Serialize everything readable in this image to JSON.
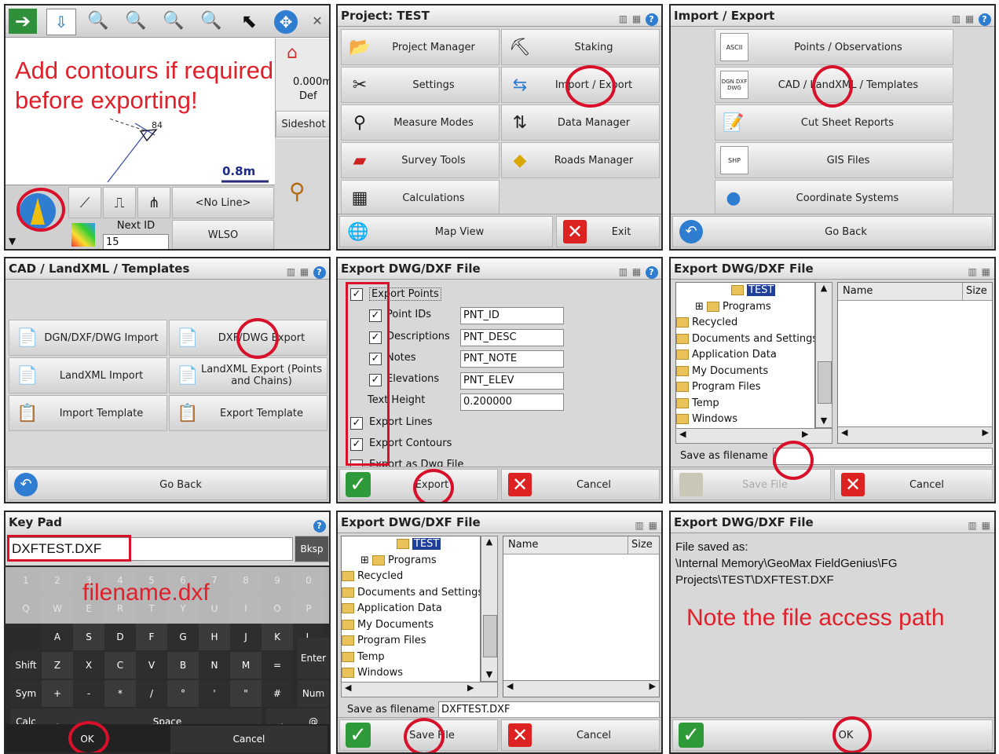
{
  "p1": {
    "toolbar_icons": [
      "arrow-right-icon",
      "arrow-down-icon",
      "zoom-fit-icon",
      "zoom-plus-minus-icon",
      "zoom-window-icon",
      "zoom-in-icon",
      "back-arrow-icon",
      "pan-icon",
      "dar-icon"
    ],
    "annotation": "Add contours if required\nbefore exporting!",
    "scale": "0.8m",
    "elev_1": "0.000m",
    "elev_2": "Def",
    "point": "84",
    "sideshot": "Sideshot",
    "no_line": "<No Line>",
    "next_id_label": "Next ID",
    "next_id_value": "15",
    "wlso": "WLSO"
  },
  "p2": {
    "title": "Project: TEST",
    "buttons": [
      "Project Manager",
      "Staking",
      "Settings",
      "Import / Export",
      "Measure Modes",
      "Data Manager",
      "Survey Tools",
      "Roads Manager",
      "Calculations"
    ],
    "map_view": "Map View",
    "exit": "Exit"
  },
  "p3": {
    "title": "Import / Export",
    "buttons": [
      "Points / Observations",
      "CAD / LandXML / Templates",
      "Cut Sheet Reports",
      "GIS Files",
      "Coordinate Systems"
    ],
    "icon_labels": [
      "ASCII",
      "DGN DXF DWG",
      "",
      "SHP",
      ""
    ],
    "go_back": "Go Back"
  },
  "p4": {
    "title": "CAD / LandXML / Templates",
    "buttons": [
      "DGN/DXF/DWG Import",
      "DXF/DWG Export",
      "LandXML Import",
      "LandXML Export (Points and Chains)",
      "Import Template",
      "Export Template"
    ],
    "go_back": "Go Back"
  },
  "p5": {
    "title": "Export DWG/DXF File",
    "export_points": "Export Points",
    "rows": [
      {
        "label": "Point IDs",
        "value": "PNT_ID"
      },
      {
        "label": "Descriptions",
        "value": "PNT_DESC"
      },
      {
        "label": "Notes",
        "value": "PNT_NOTE"
      },
      {
        "label": "Elevations",
        "value": "PNT_ELEV"
      }
    ],
    "text_height_label": "Text Height",
    "text_height_value": "0.200000",
    "export_lines": "Export Lines",
    "export_contours": "Export Contours",
    "export_dwg": "Export as Dwg File",
    "ok": "Export",
    "cancel": "Cancel"
  },
  "p6": {
    "title": "Export DWG/DXF File",
    "tree": [
      "TEST",
      "Programs",
      "Recycled",
      "Documents and Settings",
      "Application Data",
      "My Documents",
      "Program Files",
      "Temp",
      "Windows"
    ],
    "col_name": "Name",
    "col_size": "Size",
    "save_label": "Save as filename",
    "save_value": "",
    "save_btn": "Save File",
    "cancel": "Cancel"
  },
  "p7": {
    "title": "Key Pad",
    "input": "DXFTEST.DXF",
    "bksp": "Bksp",
    "row1": [
      "1",
      "2",
      "3",
      "4",
      "5",
      "6",
      "7",
      "8",
      "9",
      "0"
    ],
    "row2": [
      "Q",
      "W",
      "E",
      "R",
      "T",
      "Y",
      "U",
      "I",
      "O",
      "P"
    ],
    "row3": [
      "A",
      "S",
      "D",
      "F",
      "G",
      "H",
      "J",
      "K",
      "L"
    ],
    "row4": [
      "Shift",
      "Z",
      "X",
      "C",
      "V",
      "B",
      "N",
      "M",
      "="
    ],
    "row5": [
      "Sym",
      "+",
      "-",
      "*",
      "/",
      "°",
      "'",
      "\"",
      "#"
    ],
    "enter": "Enter",
    "num": "Num",
    "calc": "Calc",
    "comma": ",",
    "space": "Space",
    "dot": ".",
    "at": "@",
    "ok": "OK",
    "cancel": "Cancel",
    "overlay": "filename.dxf"
  },
  "p8": {
    "title": "Export DWG/DXF File",
    "tree": [
      "TEST",
      "Programs",
      "Recycled",
      "Documents and Settings",
      "Application Data",
      "My Documents",
      "Program Files",
      "Temp",
      "Windows"
    ],
    "col_name": "Name",
    "col_size": "Size",
    "save_label": "Save as filename",
    "save_value": "DXFTEST.DXF",
    "save_btn": "Save File",
    "cancel": "Cancel"
  },
  "p9": {
    "title": "Export DWG/DXF File",
    "saved_as": "File saved as:",
    "path1": "\\Internal Memory\\GeoMax FieldGenius\\FG",
    "path2": "Projects\\TEST\\DXFTEST.DXF",
    "note": "Note the file access path",
    "ok": "OK"
  },
  "colors": {
    "annotation_red": "#e0202a",
    "circle_red": "#d8102a",
    "ok_green": "#2f9a3a",
    "cancel_red": "#d22222"
  }
}
